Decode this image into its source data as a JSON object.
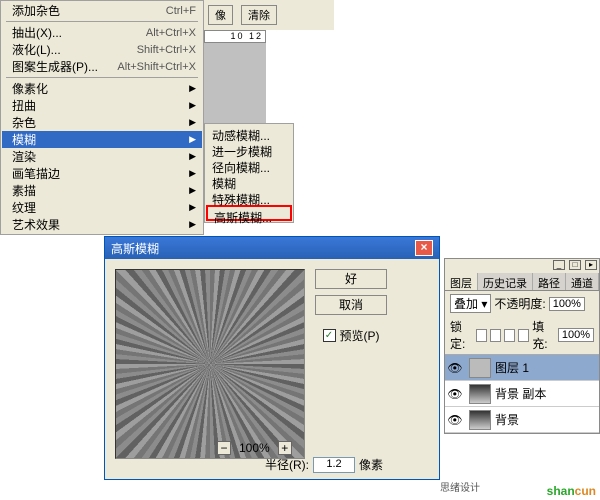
{
  "toolbar": {
    "btn_image": "像",
    "btn_clear": "清除"
  },
  "ruler": "10 12",
  "menu": {
    "items": [
      {
        "label": "添加杂色",
        "shortcut": "Ctrl+F"
      },
      {
        "label": "抽出(X)...",
        "shortcut": "Alt+Ctrl+X"
      },
      {
        "label": "液化(L)...",
        "shortcut": "Shift+Ctrl+X"
      },
      {
        "label": "图案生成器(P)...",
        "shortcut": "Alt+Shift+Ctrl+X"
      },
      {
        "label": "像素化"
      },
      {
        "label": "扭曲"
      },
      {
        "label": "杂色"
      },
      {
        "label": "模糊",
        "hl": true
      },
      {
        "label": "渲染"
      },
      {
        "label": "画笔描边"
      },
      {
        "label": "素描"
      },
      {
        "label": "纹理"
      },
      {
        "label": "艺术效果"
      }
    ]
  },
  "submenu": [
    "动感模糊...",
    "进一步模糊",
    "径向模糊...",
    "模糊",
    "特殊模糊...",
    "高斯模糊..."
  ],
  "dialog": {
    "title": "高斯模糊",
    "ok": "好",
    "cancel": "取消",
    "preview": "预览(P)",
    "zoom": "100%",
    "radius_label": "半径(R):",
    "radius_value": "1.2",
    "unit": "像素"
  },
  "layers": {
    "tabs": [
      "图层",
      "历史记录",
      "路径",
      "通道"
    ],
    "blend": "叠加",
    "opacity_label": "不透明度:",
    "opacity": "100%",
    "lock_label": "锁定:",
    "fill_label": "填充:",
    "fill": "100%",
    "rows": [
      {
        "name": "图层 1"
      },
      {
        "name": "背景 副本"
      },
      {
        "name": "背景"
      }
    ]
  },
  "footer": {
    "sixu": "思绪设计",
    "logo1": "shan",
    "logo2": "cun"
  }
}
